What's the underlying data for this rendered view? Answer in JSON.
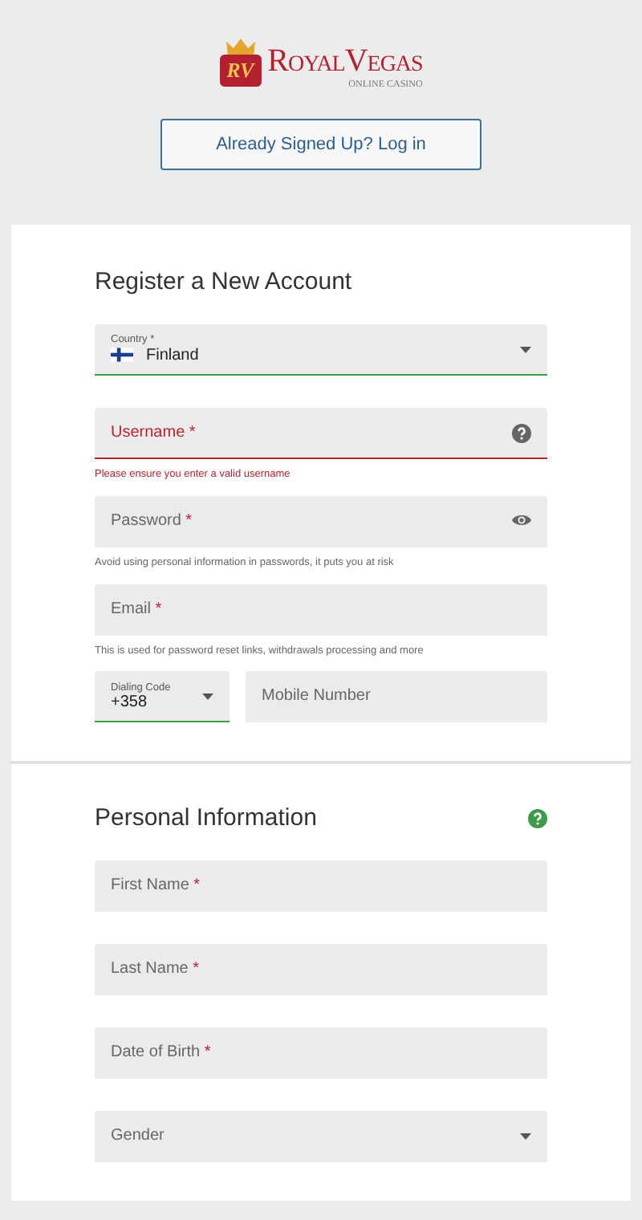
{
  "logo": {
    "badge": "RV",
    "name": "RoyalVegas",
    "tagline": "ONLINE CASINO"
  },
  "login_button": "Already Signed Up? Log in",
  "sections": [
    {
      "title": "Register a New Account",
      "fields": [
        {
          "kind": "select",
          "label": "Country",
          "mark": "*",
          "value": "Finland",
          "flag": true,
          "valid": true
        },
        {
          "kind": "text",
          "label": "Username",
          "mark": "*",
          "invalid": true,
          "help_icon": true,
          "hint": "Please ensure you enter a valid username"
        },
        {
          "kind": "text",
          "label": "Password",
          "mark": "*",
          "reveal_icon": true,
          "hint": "Avoid using personal information in passwords, it puts you at risk"
        },
        {
          "kind": "text",
          "label": "Email",
          "mark": "*",
          "hint": "This is used for password reset links, withdrawals processing and more"
        },
        {
          "kind": "phone",
          "code": {
            "label": "Dialing Code",
            "value": "+358",
            "valid": true
          },
          "number": {
            "label": "Mobile Number"
          }
        }
      ]
    },
    {
      "title": "Personal Information",
      "help": true,
      "fields": [
        {
          "kind": "text",
          "label": "First Name",
          "mark": "*"
        },
        {
          "kind": "text",
          "label": "Last Name",
          "mark": "*"
        },
        {
          "kind": "text",
          "label": "Date of Birth",
          "mark": "*"
        },
        {
          "kind": "dropdown",
          "label": "Gender"
        }
      ]
    }
  ]
}
